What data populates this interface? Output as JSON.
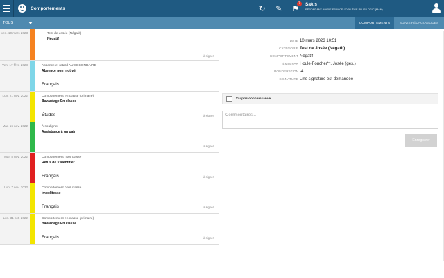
{
  "header": {
    "app_title": "Comportements",
    "user_name": "Sakis",
    "user_role": "RÉPONDANT: MARIE-FRANCE / COLLÈGE PLURILOGIC (MAN)",
    "notification_count": "7",
    "sync_icon": "sync-icon",
    "edit_icon": "pen-icon",
    "flag_icon": "flag-icon",
    "user_icon": "user-icon"
  },
  "subbar": {
    "filter_label": "TOUS",
    "tab_behaviors": "COMPORTEMENTS",
    "tab_pedagogical": "SUIVIS PÉDAGOGIQUES"
  },
  "list": {
    "items": [
      {
        "date": "Ven. 10 mars 2023",
        "category": "Test de Josée (Négatif)",
        "title": "Négatif",
        "subject": "",
        "sign": "à signer",
        "color": "#f58220"
      },
      {
        "date": "Ven. 17 févr. 2023",
        "category": "Absence et retard AU SECONDAIRE",
        "title": "Absence non motivé",
        "subject": "Français",
        "sign": "",
        "color": "#7fd6e8"
      },
      {
        "date": "Lun. 21 nov. 2022",
        "category": "Comportement en classe (primaire)",
        "title": "Bavardage En classe",
        "subject": "Études",
        "sign": "à signer",
        "color": "#f3e500"
      },
      {
        "date": "Mar. 16 nov. 2022",
        "category": "À souligner",
        "title": "Assistance à un pair",
        "subject": "",
        "sign": "à signer",
        "color": "#2fb84a"
      },
      {
        "date": "Mar. 8 nov. 2022",
        "category": "Comportement hors classe",
        "title": "Refus de s'identifier",
        "subject": "Français",
        "sign": "à signer",
        "color": "#e02020"
      },
      {
        "date": "Lun. 7 nov. 2022",
        "category": "Comportement hors classe",
        "title": "Impolitesse",
        "subject": "Français",
        "sign": "à signer",
        "color": "#f3e500"
      },
      {
        "date": "Lun. 31 oct. 2022",
        "category": "Comportement en classe (primaire)",
        "title": "Bavardage En classe",
        "subject": "Français",
        "sign": "à signer",
        "color": "#f3e500"
      }
    ]
  },
  "detail": {
    "date_label": "DATE",
    "date_value": "10 mars 2023 10:51",
    "category_label": "CATÉGORIE",
    "category_value": "Test de Josée (Négatif)",
    "behavior_label": "COMPORTEMENT",
    "behavior_value": "Négatif",
    "issued_label": "ÉMIS PAR",
    "issued_value": "Houle-Foucher**, Josée (ges.)",
    "weight_label": "PONDÉRATION",
    "weight_value": "-4",
    "signature_label": "SIGNATURE",
    "signature_value": "Une signature est demandée"
  },
  "ack": {
    "label": "J'ai pris connaissance",
    "comments_placeholder": "Commentaires...",
    "save_label": "Enregistrer"
  }
}
